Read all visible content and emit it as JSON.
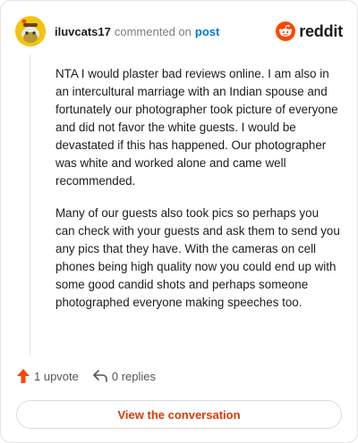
{
  "header": {
    "username": "iluvcats17",
    "action_text": "commented on",
    "post_link": "post",
    "brand": "reddit"
  },
  "comment": {
    "paragraphs": [
      "NTA I would plaster bad reviews online. I am also in an intercultural marriage with an Indian spouse and fortunately our photographer took picture of everyone and did not favor the white guests. I would be devastated if this has happened. Our photographer was white and worked alone and came well recommended.",
      "Many of our guests also took pics so perhaps you can check with your guests and ask them to send you any pics that they have. With the cameras on cell phones being high quality now you could end up with some good candid shots and perhaps someone photographed everyone making speeches too."
    ]
  },
  "actions": {
    "upvote_label": "1 upvote",
    "replies_label": "0 replies"
  },
  "footer": {
    "view_button": "View the conversation"
  },
  "colors": {
    "upvote_accent": "#ff4500",
    "link_blue": "#0079d3",
    "button_text": "#d93a00",
    "avatar_bg": "#f2c40f"
  },
  "icons": {
    "avatar": "snoo-avatar-icon",
    "brand": "reddit-snoo-icon",
    "upvote": "upvote-arrow-icon",
    "reply": "reply-arrow-icon"
  }
}
